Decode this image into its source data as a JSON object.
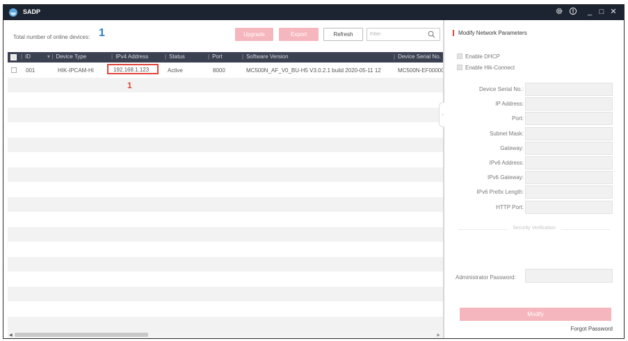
{
  "app": {
    "title": "SADP"
  },
  "titlebar": {
    "settings_icon": "gear-icon",
    "about_icon": "info-icon",
    "minimize": "_",
    "maximize": "□",
    "close": "✕"
  },
  "toolbar": {
    "total_label": "Total number of online devices:",
    "total_count": "1",
    "upgrade_label": "Upgrade",
    "export_label": "Export",
    "refresh_label": "Refresh",
    "filter_placeholder": "Filter"
  },
  "table": {
    "columns": [
      "ID",
      "Device Type",
      "IPv4 Address",
      "Status",
      "Port",
      "Software Version",
      "Device Serial No."
    ],
    "rows": [
      {
        "id": "001",
        "device_type": "HIK-IPCAM-HI",
        "ipv4": "192.168.1.123",
        "status": "Active",
        "port": "8000",
        "software_version": "MC500N_AF_V0_BU-H5 V3.0.2.1 build 2020-05-11 12",
        "serial": "MC500N-EF00000"
      }
    ],
    "empty_row_count": 17
  },
  "annotation": {
    "callout": "1",
    "color": "#e04438"
  },
  "panel": {
    "title": "Modify Network Parameters",
    "enable_dhcp": "Enable DHCP",
    "enable_hik_connect": "Enable Hik-Connect",
    "fields": {
      "serial": "Device Serial No.:",
      "ip": "IP Address:",
      "port": "Port:",
      "subnet": "Subnet Mask:",
      "gateway": "Gateway:",
      "ipv6": "IPv6 Address:",
      "ipv6_gateway": "IPv6 Gateway:",
      "ipv6_prefix": "IPv6 Prefix Length:",
      "http_port": "HTTP Port:"
    },
    "security_verification": "Security Verification",
    "admin_password_label": "Administrator Password:",
    "modify_label": "Modify",
    "forgot_password": "Forgot Password"
  },
  "colors": {
    "titlebar": "#1d2431",
    "header": "#3b4151",
    "accent_red": "#e04438",
    "count_blue": "#2b7fc6",
    "disabled_button": "#f6b6bd"
  }
}
